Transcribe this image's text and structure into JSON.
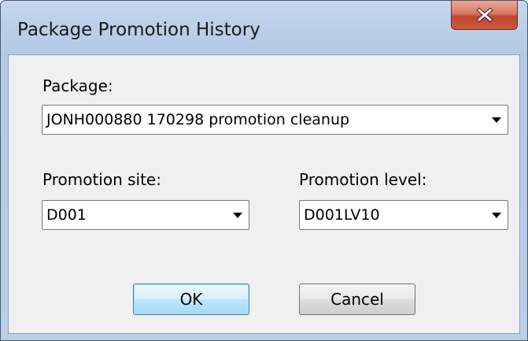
{
  "window": {
    "title": "Package Promotion History",
    "close_glyph": "x"
  },
  "package": {
    "label": "Package:",
    "value": "JONH000880   170298 promotion cleanup"
  },
  "promotion_site": {
    "label": "Promotion site:",
    "value": "D001"
  },
  "promotion_level": {
    "label": "Promotion level:",
    "value": "D001LV10"
  },
  "buttons": {
    "ok": "OK",
    "cancel": "Cancel"
  },
  "colors": {
    "title_bar": "#b9cfe8",
    "client_bg": "#f0f0f0",
    "close_button": "#c2452e",
    "default_button_border": "#3c7fb1"
  }
}
